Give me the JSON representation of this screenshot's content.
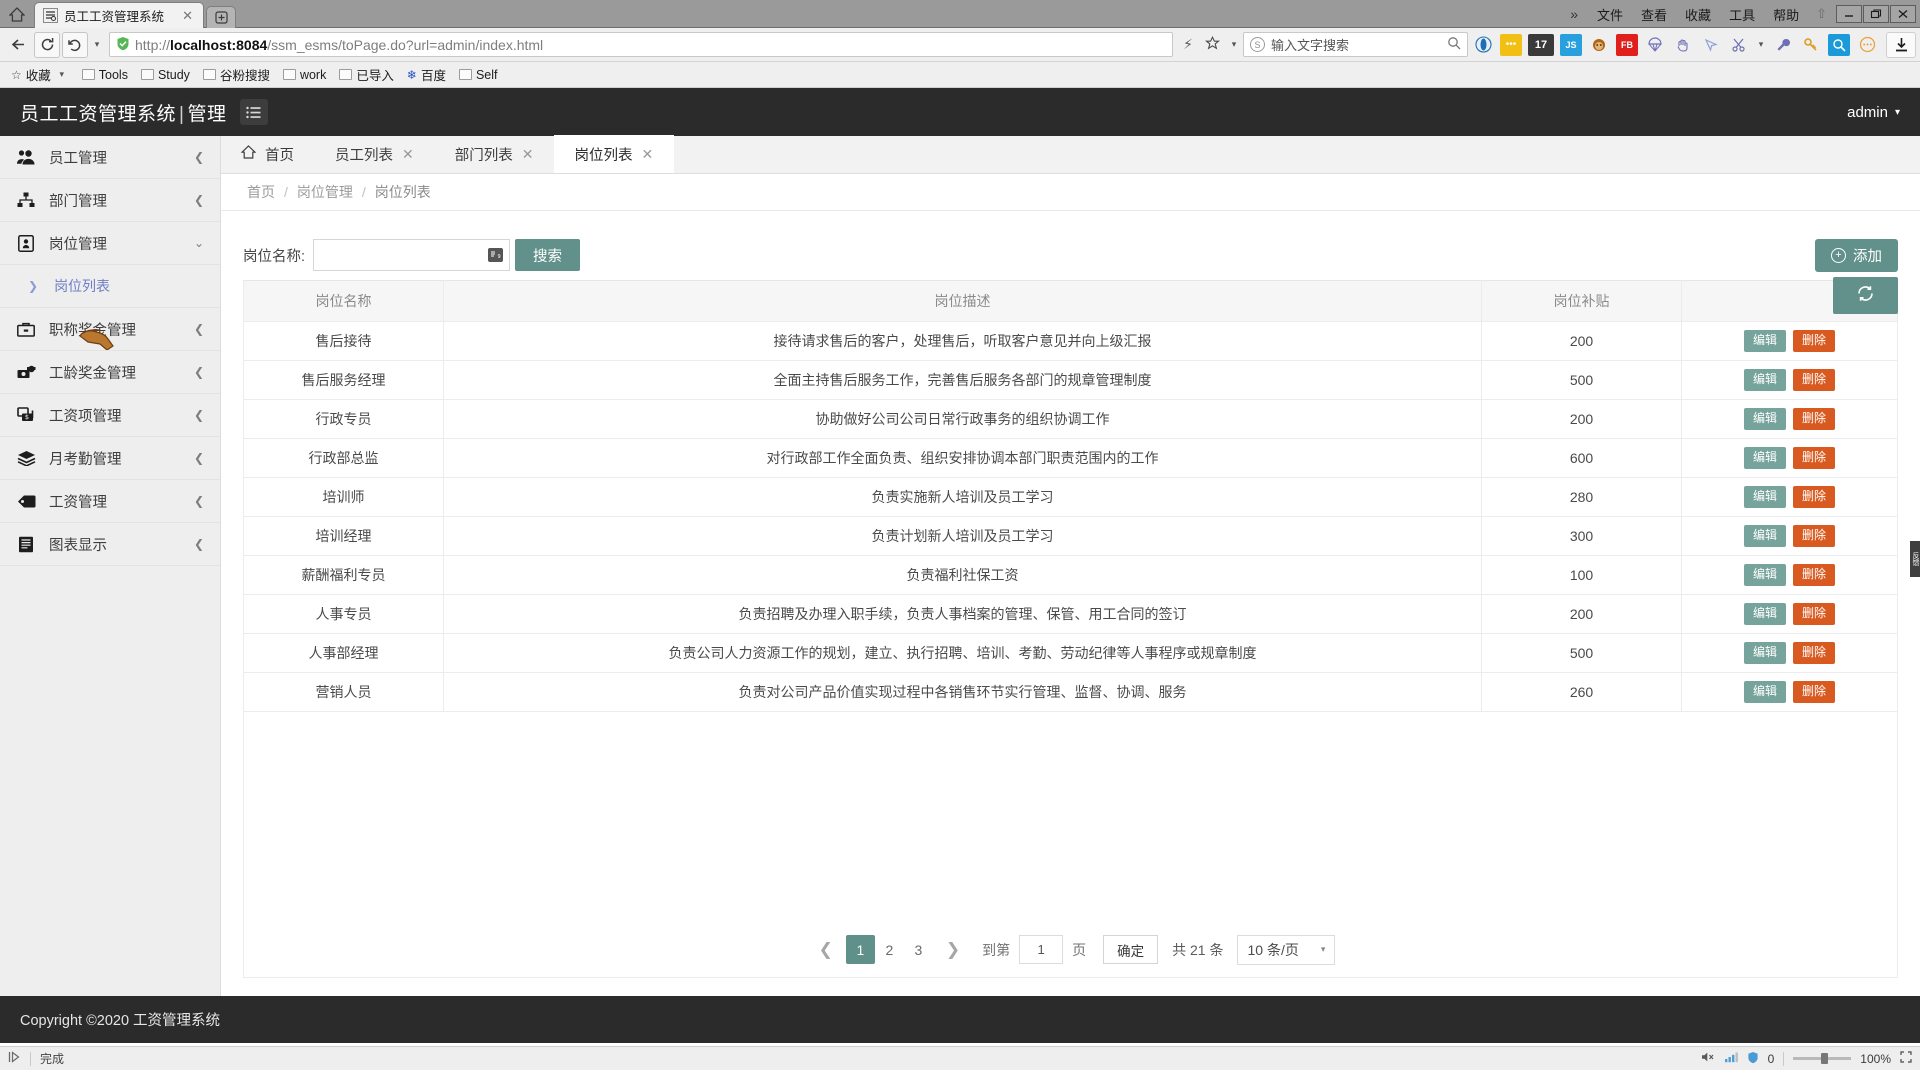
{
  "browser": {
    "tab_title": "员工工资管理系统",
    "tab_close": "✕",
    "new_tab": "+",
    "home_icon": "⌂",
    "back_icon": "←",
    "reload_icon": "⟳",
    "history_icon": "↺",
    "dropdown_icon": "▾",
    "url_secure_icon": "✔",
    "url_prefix": "http://",
    "url_host": "localhost:8084",
    "url_path": "/ssm_esms/toPage.do?url=admin/index.html",
    "lightning_icon": "⚡",
    "star_icon": "☆",
    "search_engine_icon": "Ⓢ",
    "search_placeholder": "输入文字搜索",
    "search_magnifier": "⌕",
    "download_icon": "⬇",
    "menu": {
      "overflow": "»",
      "items": [
        "文件",
        "查看",
        "收藏",
        "工具",
        "帮助"
      ],
      "pin_icon": "⇧",
      "minimize": "—",
      "maximize": "❐",
      "close": "✕"
    },
    "extensions": [
      {
        "name": "opera-icon",
        "glyph": "O",
        "bg": "#ffffff",
        "color": "#1f6fb5"
      },
      {
        "name": "yellow-dots-icon",
        "glyph": "•••",
        "bg": "#f2c013",
        "color": "#ffffff"
      },
      {
        "name": "counter-badge-icon",
        "glyph": "17",
        "bg": "#3a3a3a",
        "color": "#ffffff"
      },
      {
        "name": "js-icon",
        "glyph": "JS",
        "bg": "#27a0dd",
        "color": "#ffffff"
      },
      {
        "name": "monkey-icon",
        "glyph": "🐵",
        "bg": "transparent",
        "color": "#b3640f"
      },
      {
        "name": "firebug-icon",
        "glyph": "FB",
        "bg": "#e0201d",
        "color": "#ffffff"
      },
      {
        "name": "parachute-icon",
        "glyph": "☂",
        "bg": "transparent",
        "color": "#6f6fb5"
      },
      {
        "name": "hand-icon",
        "glyph": "✋",
        "bg": "transparent",
        "color": "#6f6fb5"
      },
      {
        "name": "cursor-arrow-icon",
        "glyph": "➢",
        "bg": "transparent",
        "color": "#8ea0d8"
      },
      {
        "name": "scissors-icon",
        "glyph": "✂",
        "bg": "transparent",
        "color": "#6f6fb5"
      },
      {
        "name": "wrench-icon",
        "glyph": "🔧",
        "bg": "transparent",
        "color": "#6f6fb5"
      },
      {
        "name": "key-icon",
        "glyph": "🔑",
        "bg": "transparent",
        "color": "#e09a25"
      },
      {
        "name": "inspect-icon",
        "glyph": "🔍",
        "bg": "#1a9ad8",
        "color": "#ffffff"
      },
      {
        "name": "more-circle-icon",
        "glyph": "⋯",
        "bg": "transparent",
        "color": "#e8a33d"
      }
    ],
    "bookmarks": [
      {
        "label": "收藏",
        "type": "star"
      },
      {
        "label": "Tools",
        "type": "folder"
      },
      {
        "label": "Study",
        "type": "folder"
      },
      {
        "label": "谷粉搜搜",
        "type": "page"
      },
      {
        "label": "work",
        "type": "folder"
      },
      {
        "label": "已导入",
        "type": "folder"
      },
      {
        "label": "百度",
        "type": "baidu"
      },
      {
        "label": "Self",
        "type": "folder"
      }
    ],
    "bookmark_caret": "▾"
  },
  "header": {
    "title": "员工工资管理系统",
    "separator": "|",
    "subtitle": "管理",
    "menu_icon": "hamburger-icon",
    "user": "admin",
    "user_caret": "▾"
  },
  "sidebar": {
    "items": [
      {
        "label": "员工管理",
        "icon": "users-icon",
        "glyph": "👥",
        "arrow": "❮",
        "expanded": false
      },
      {
        "label": "部门管理",
        "icon": "sitemap-icon",
        "glyph": "⛬",
        "arrow": "❮",
        "expanded": false
      },
      {
        "label": "岗位管理",
        "icon": "badge-icon",
        "glyph": "▣",
        "arrow": "⌄",
        "expanded": true
      },
      {
        "label": "职称奖金管理",
        "icon": "briefcase-icon",
        "glyph": "💼",
        "arrow": "❮",
        "expanded": false
      },
      {
        "label": "工龄奖金管理",
        "icon": "money-icon",
        "glyph": "💵",
        "arrow": "❮",
        "expanded": false
      },
      {
        "label": "工资项管理",
        "icon": "cash-icon",
        "glyph": "🖻",
        "arrow": "❮",
        "expanded": false
      },
      {
        "label": "月考勤管理",
        "icon": "layers-icon",
        "glyph": "❖",
        "arrow": "❮",
        "expanded": false
      },
      {
        "label": "工资管理",
        "icon": "tag-icon",
        "glyph": "🏷",
        "arrow": "❮",
        "expanded": false
      },
      {
        "label": "图表显示",
        "icon": "chart-icon",
        "glyph": "▤",
        "arrow": "❮",
        "expanded": false
      }
    ],
    "submenu": {
      "label": "岗位列表",
      "arrow": "❯",
      "parent_index": 2
    }
  },
  "tabs": [
    {
      "label": "首页",
      "closable": false,
      "active": false,
      "home_icon": "⌂"
    },
    {
      "label": "员工列表",
      "closable": true,
      "active": false,
      "close": "✕"
    },
    {
      "label": "部门列表",
      "closable": true,
      "active": false,
      "close": "✕"
    },
    {
      "label": "岗位列表",
      "closable": true,
      "active": true,
      "close": "✕"
    }
  ],
  "breadcrumb": {
    "items": [
      "首页",
      "岗位管理",
      "岗位列表"
    ],
    "separator": "/"
  },
  "refresh_button": {
    "icon": "refresh-icon",
    "glyph": "⟳"
  },
  "toolbar": {
    "search_label": "岗位名称:",
    "search_value": "",
    "search_placeholder": "",
    "ime_badge": "中",
    "search_button": "搜索",
    "add_button": "添加",
    "add_plus": "+"
  },
  "table": {
    "columns": [
      "岗位名称",
      "岗位描述",
      "岗位补贴",
      ""
    ],
    "rows": [
      {
        "name": "售后接待",
        "desc": "接待请求售后的客户，处理售后，听取客户意见并向上级汇报",
        "subsidy": "200"
      },
      {
        "name": "售后服务经理",
        "desc": "全面主持售后服务工作，完善售后服务各部门的规章管理制度",
        "subsidy": "500"
      },
      {
        "name": "行政专员",
        "desc": "协助做好公司公司日常行政事务的组织协调工作",
        "subsidy": "200"
      },
      {
        "name": "行政部总监",
        "desc": "对行政部工作全面负责、组织安排协调本部门职责范围内的工作",
        "subsidy": "600"
      },
      {
        "name": "培训师",
        "desc": "负责实施新人培训及员工学习",
        "subsidy": "280"
      },
      {
        "name": "培训经理",
        "desc": "负责计划新人培训及员工学习",
        "subsidy": "300"
      },
      {
        "name": "薪酬福利专员",
        "desc": "负责福利社保工资",
        "subsidy": "100"
      },
      {
        "name": "人事专员",
        "desc": "负责招聘及办理入职手续，负责人事档案的管理、保管、用工合同的签订",
        "subsidy": "200"
      },
      {
        "name": "人事部经理",
        "desc": "负责公司人力资源工作的规划，建立、执行招聘、培训、考勤、劳动纪律等人事程序或规章制度",
        "subsidy": "500"
      },
      {
        "name": "营销人员",
        "desc": "负责对公司产品价值实现过程中各销售环节实行管理、监督、协调、服务",
        "subsidy": "260"
      }
    ],
    "edit_label": "编辑",
    "delete_label": "删除"
  },
  "pagination": {
    "prev": "❮",
    "next": "❯",
    "pages": [
      "1",
      "2",
      "3"
    ],
    "current_page": "1",
    "goto_label": "到第",
    "goto_value": "1",
    "page_unit": "页",
    "confirm": "确定",
    "total": "共 21 条",
    "per_page": "10 条/页",
    "caret": "▾"
  },
  "footer": {
    "copyright": "Copyright ©2020 工资管理系统"
  },
  "statusbar": {
    "play_icon": "▷",
    "status": "完成",
    "mute_icon": "🔇",
    "wifi_icon": "📶",
    "shield_icon": "🛡",
    "block_count": "0",
    "zoom_level": "100%",
    "fullscreen_icon": "⛶"
  },
  "side_handle": {
    "label": "反馈"
  },
  "colors": {
    "accent": "#62908a",
    "danger": "#d85a20",
    "header_bg": "#2b2b2b",
    "sidebar_bg": "#eeeeee",
    "link": "#6f7ec4"
  }
}
